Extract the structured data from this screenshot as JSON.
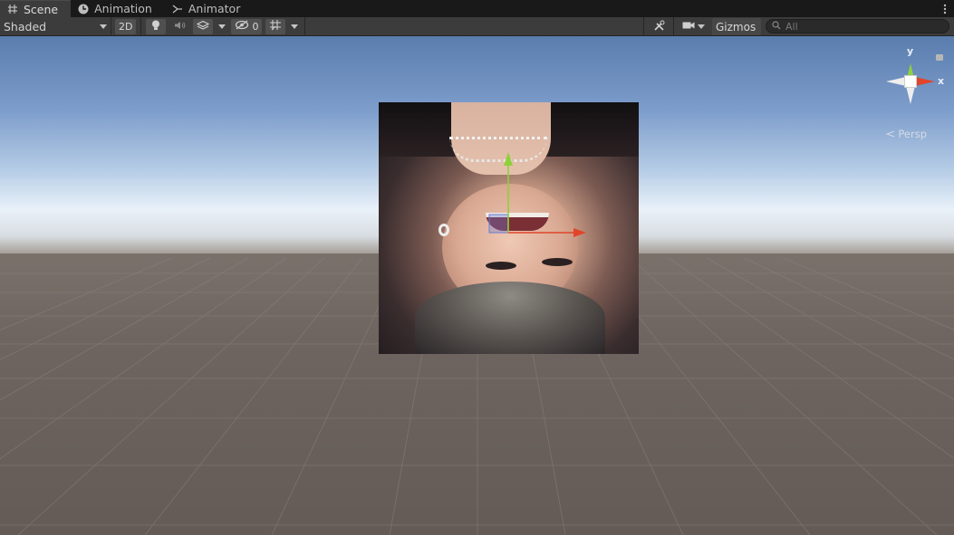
{
  "tabs": [
    {
      "label": "Scene",
      "icon": "hash-icon",
      "active": true
    },
    {
      "label": "Animation",
      "icon": "clock-icon",
      "active": false
    },
    {
      "label": "Animator",
      "icon": "animator-icon",
      "active": false
    }
  ],
  "toolbar": {
    "shading_mode": "Shaded",
    "mode_2d_label": "2D",
    "hidden_count": "0",
    "gizmos_label": "Gizmos",
    "search_placeholder": "All"
  },
  "scene": {
    "view_label": "Persp",
    "axis_x_label": "x",
    "axis_y_label": "y",
    "colors": {
      "x_axis": "#e0452a",
      "y_axis": "#8fd13a",
      "z_axis": "#6b7bd6"
    }
  }
}
